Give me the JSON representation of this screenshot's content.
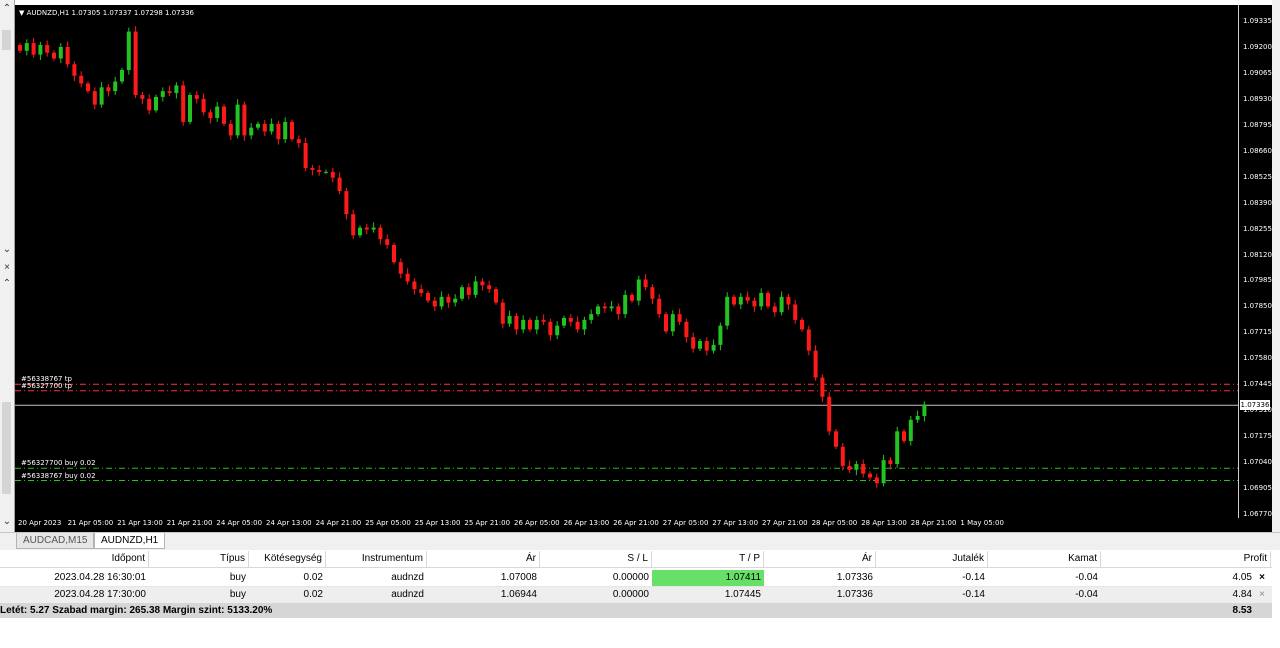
{
  "chart": {
    "title": "AUDNZD,H1  1.07305 1.07337 1.07298 1.07336",
    "current_price": "1.07336",
    "price_ticks": [
      "1.09335",
      "1.09200",
      "1.09065",
      "1.08930",
      "1.08795",
      "1.08660",
      "1.08525",
      "1.08390",
      "1.08255",
      "1.08120",
      "1.07985",
      "1.07850",
      "1.07715",
      "1.07580",
      "1.07445",
      "1.07310",
      "1.07175",
      "1.07040",
      "1.06905",
      "1.06770"
    ],
    "time_ticks": [
      "20 Apr 2023",
      "21 Apr 05:00",
      "21 Apr 13:00",
      "21 Apr 21:00",
      "24 Apr 05:00",
      "24 Apr 13:00",
      "24 Apr 21:00",
      "25 Apr 05:00",
      "25 Apr 13:00",
      "25 Apr 21:00",
      "26 Apr 05:00",
      "26 Apr 13:00",
      "26 Apr 21:00",
      "27 Apr 05:00",
      "27 Apr 13:00",
      "27 Apr 21:00",
      "28 Apr 05:00",
      "28 Apr 13:00",
      "28 Apr 21:00",
      "1 May 05:00"
    ],
    "level_labels": {
      "tp1": "#56338767 tp",
      "tp2": "#56327700 tp",
      "buy1": "#56327700 buy 0.02",
      "buy2": "#56338767 buy 0.02"
    },
    "levels": {
      "tp1": 1.07445,
      "tp2": 1.07411,
      "buy1": 1.07008,
      "buy2": 1.06944,
      "current": 1.07336
    },
    "colors": {
      "bull": "#22c322",
      "bear": "#ff1a1a",
      "tp_line": "#ff3030",
      "buy_line": "#22c322",
      "price_line": "#c0c0c0"
    },
    "closes": [
      1.0918,
      1.0922,
      1.0916,
      1.0921,
      1.0917,
      1.0914,
      1.092,
      1.0911,
      1.0905,
      1.0901,
      1.0897,
      1.089,
      1.0899,
      1.0897,
      1.0902,
      1.0908,
      1.0928,
      1.0895,
      1.0893,
      1.0887,
      1.0894,
      1.0897,
      1.0896,
      1.09,
      1.0881,
      1.0895,
      1.0893,
      1.0886,
      1.0883,
      1.0889,
      1.088,
      1.0874,
      1.089,
      1.0874,
      1.0878,
      1.088,
      1.0876,
      1.088,
      1.0872,
      1.0881,
      1.0872,
      1.087,
      1.0857,
      1.0856,
      1.0855,
      1.0855,
      1.0852,
      1.0845,
      1.0833,
      1.0822,
      1.0826,
      1.0825,
      1.0826,
      1.082,
      1.0817,
      1.0808,
      1.0802,
      1.0798,
      1.0794,
      1.0792,
      1.0788,
      1.0785,
      1.079,
      1.0787,
      1.0789,
      1.0795,
      1.0791,
      1.0798,
      1.0796,
      1.0794,
      1.0787,
      1.0776,
      1.078,
      1.0773,
      1.0778,
      1.0773,
      1.0778,
      1.0777,
      1.077,
      1.0775,
      1.0779,
      1.0777,
      1.0773,
      1.0778,
      1.0781,
      1.0785,
      1.0784,
      1.0785,
      1.0781,
      1.0791,
      1.0788,
      1.0799,
      1.0795,
      1.0789,
      1.0781,
      1.0772,
      1.0781,
      1.0777,
      1.0769,
      1.0763,
      1.0767,
      1.0762,
      1.0765,
      1.0775,
      1.079,
      1.0786,
      1.079,
      1.0788,
      1.0785,
      1.0792,
      1.0785,
      1.0782,
      1.079,
      1.0786,
      1.0778,
      1.0773,
      1.0762,
      1.0748,
      1.0738,
      1.072,
      1.0712,
      1.0702,
      1.07,
      1.0703,
      1.0698,
      1.0696,
      1.0693,
      1.0705,
      1.0703,
      1.072,
      1.0715,
      1.0726,
      1.0728,
      1.0734
    ]
  },
  "tabs": [
    {
      "label": "AUDCAD,M15",
      "active": false
    },
    {
      "label": "AUDNZD,H1",
      "active": true
    }
  ],
  "terminal": {
    "columns": [
      "Időpont",
      "Típus",
      "Kötésegység",
      "Instrumentum",
      "Ár",
      "S / L",
      "T / P",
      "Ár",
      "Jutalék",
      "Kamat",
      "Profit"
    ],
    "rows": [
      [
        "2023.04.28 16:30:01",
        "buy",
        "0.02",
        "audnzd",
        "1.07008",
        "0.00000",
        "1.07411",
        "1.07336",
        "-0.14",
        "-0.04",
        "4.05"
      ],
      [
        "2023.04.28 17:30:00",
        "buy",
        "0.02",
        "audnzd",
        "1.06944",
        "0.00000",
        "1.07445",
        "1.07336",
        "-0.14",
        "-0.04",
        "4.84"
      ]
    ],
    "summary": "Letét: 5.27  Szabad margin: 265.38  Margin szint: 5133.20%",
    "total_profit": "8.53",
    "close_icon_glyph": "×"
  }
}
